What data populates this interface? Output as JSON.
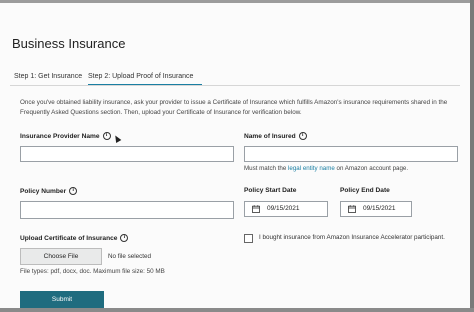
{
  "page": {
    "title": "Business Insurance"
  },
  "tabs": [
    {
      "label": "Step 1: Get Insurance",
      "active": false
    },
    {
      "label": "Step 2: Upload Proof of Insurance",
      "active": true
    }
  ],
  "intro_text": "Once you've obtained liability insurance, ask your provider to issue a Certificate of Insurance which fulfills Amazon's insurance requirements shared in the Frequently Asked Questions section. Then, upload your Certificate of Insurance for verification below.",
  "form": {
    "insurance_provider_name": {
      "label": "Insurance Provider Name",
      "value": ""
    },
    "name_of_insured": {
      "label": "Name of Insured",
      "value": "",
      "helper_before": "Must match the ",
      "helper_link": "legal entity name",
      "helper_after": " on Amazon account page."
    },
    "policy_number": {
      "label": "Policy Number",
      "value": ""
    },
    "policy_start_date": {
      "label": "Policy Start Date",
      "value": "09/15/2021"
    },
    "policy_end_date": {
      "label": "Policy End Date",
      "value": "09/15/2021"
    },
    "upload_certificate": {
      "label": "Upload Certificate of Insurance",
      "choose_button": "Choose File",
      "no_file_text": "No file selected",
      "file_types": "File types: pdf, docx, doc. Maximum file size: 50 MB"
    },
    "accelerator_checkbox": {
      "label": "I bought insurance from Amazon Insurance Accelerator participant.",
      "checked": false
    },
    "submit_button": "Submit"
  },
  "icons": {
    "info": "info-icon",
    "calendar": "calendar-icon"
  },
  "colors": {
    "accent": "#1a7fa3",
    "submit_bg": "#1f6c7f"
  }
}
